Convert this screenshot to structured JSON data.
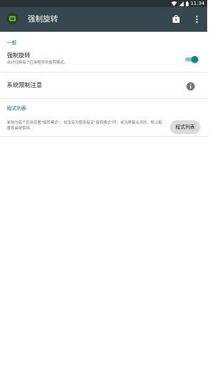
{
  "status_bar": {
    "time": "11:34"
  },
  "toolbar": {
    "title": "强制旋转"
  },
  "general": {
    "header": "一般",
    "force_rotation": {
      "title": "强制旋转",
      "summary": "自动切换每个应用程序的旋转模式。",
      "enabled": true
    },
    "system_restriction": {
      "title": "系统限制注意"
    }
  },
  "app_list": {
    "header": "程式列表",
    "summary": "单独为每个应用设置\"旋转模式\"。如没有为程序指定\"旋转模式\"时，或当屏幕关闭时，默认配置将会被套用。",
    "button_label": "程式列表"
  },
  "colors": {
    "toolbar": "#37474f",
    "status_bar": "#263238",
    "accent": "#00796b",
    "toggle_thumb": "#00897b"
  }
}
